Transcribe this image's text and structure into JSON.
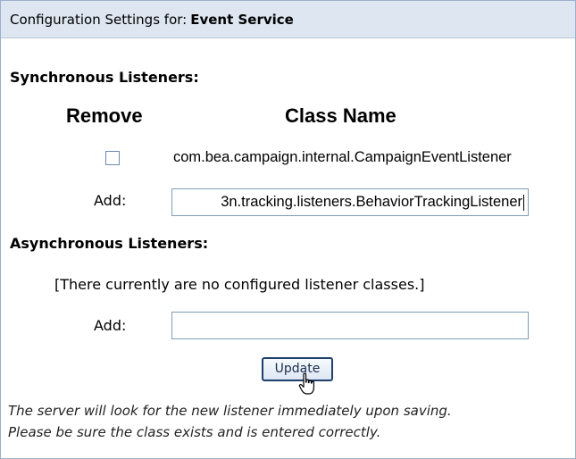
{
  "header": {
    "prefix": "Configuration Settings for:",
    "service_name": "Event Service"
  },
  "sync": {
    "title": "Synchronous Listeners:",
    "col_remove": "Remove",
    "col_class": "Class Name",
    "listeners": [
      {
        "checked": false,
        "class_name": "com.bea.campaign.internal.CampaignEventListener"
      }
    ],
    "add_label": "Add:",
    "add_value": "3n.tracking.listeners.BehaviorTrackingListener"
  },
  "async": {
    "title": "Asynchronous Listeners:",
    "empty_message": "[There currently are no configured listener classes.]",
    "add_label": "Add:",
    "add_value": ""
  },
  "update_button": "Update",
  "note": {
    "line1": "The server will look for the new listener immediately upon saving.",
    "line2": "Please be sure the class exists and is entered correctly."
  },
  "colors": {
    "header_bg": "#dde6f1",
    "border": "#9db0c8",
    "button_border": "#1f3f6e"
  },
  "icons": {
    "cursor": "hand-pointer-icon"
  }
}
